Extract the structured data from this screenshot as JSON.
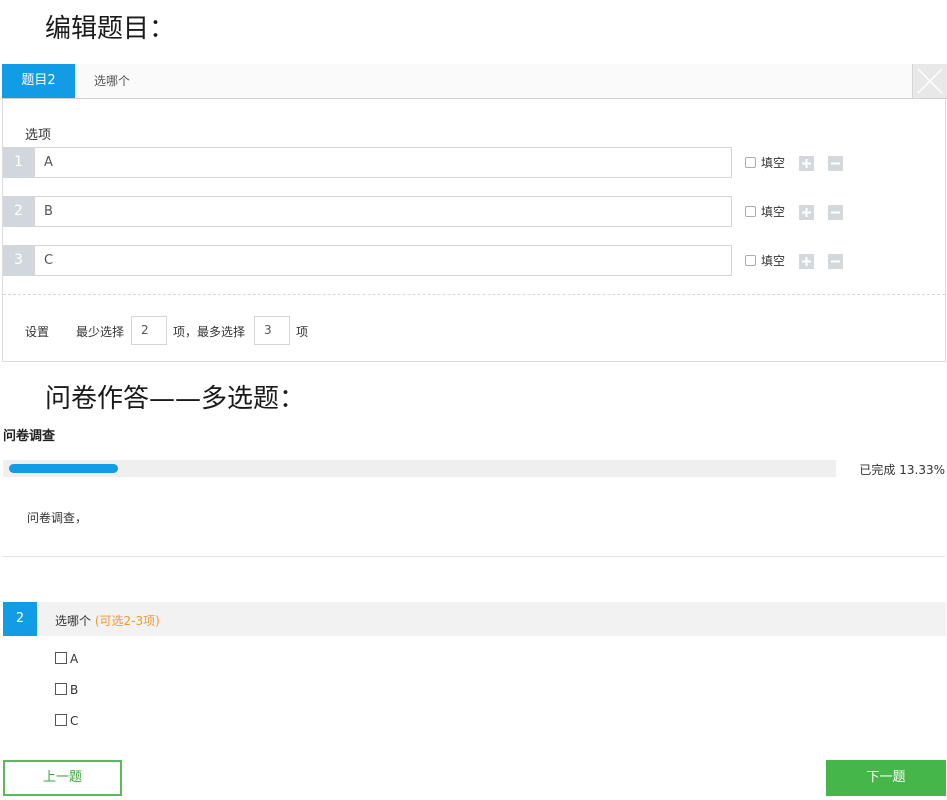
{
  "headings": {
    "edit": "编辑题目：",
    "answer": "问卷作答——多选题："
  },
  "editor": {
    "tabs": {
      "active": "题目2",
      "other": "选哪个"
    },
    "options_label": "选项",
    "options": [
      {
        "num": "1",
        "value": "A",
        "fill_label": "填空"
      },
      {
        "num": "2",
        "value": "B",
        "fill_label": "填空"
      },
      {
        "num": "3",
        "value": "C",
        "fill_label": "填空"
      }
    ],
    "settings": {
      "label": "设置",
      "min_label": "最少选择",
      "min_value": "2",
      "mid_label": "项，最多选择",
      "max_value": "3",
      "end_label": "项"
    }
  },
  "survey": {
    "title": "问卷调查",
    "progress_percent": 13.33,
    "progress_text": "已完成 13.33%",
    "intro": "问卷调查，",
    "question": {
      "number": "2",
      "text": "选哪个",
      "hint": "(可选2-3项)",
      "choices": [
        "A",
        "B",
        "C"
      ]
    },
    "prev_button": "上一题",
    "next_button": "下一题"
  },
  "colors": {
    "accent": "#139ce6",
    "hint": "#f39a2e",
    "next_button": "#45b649"
  }
}
